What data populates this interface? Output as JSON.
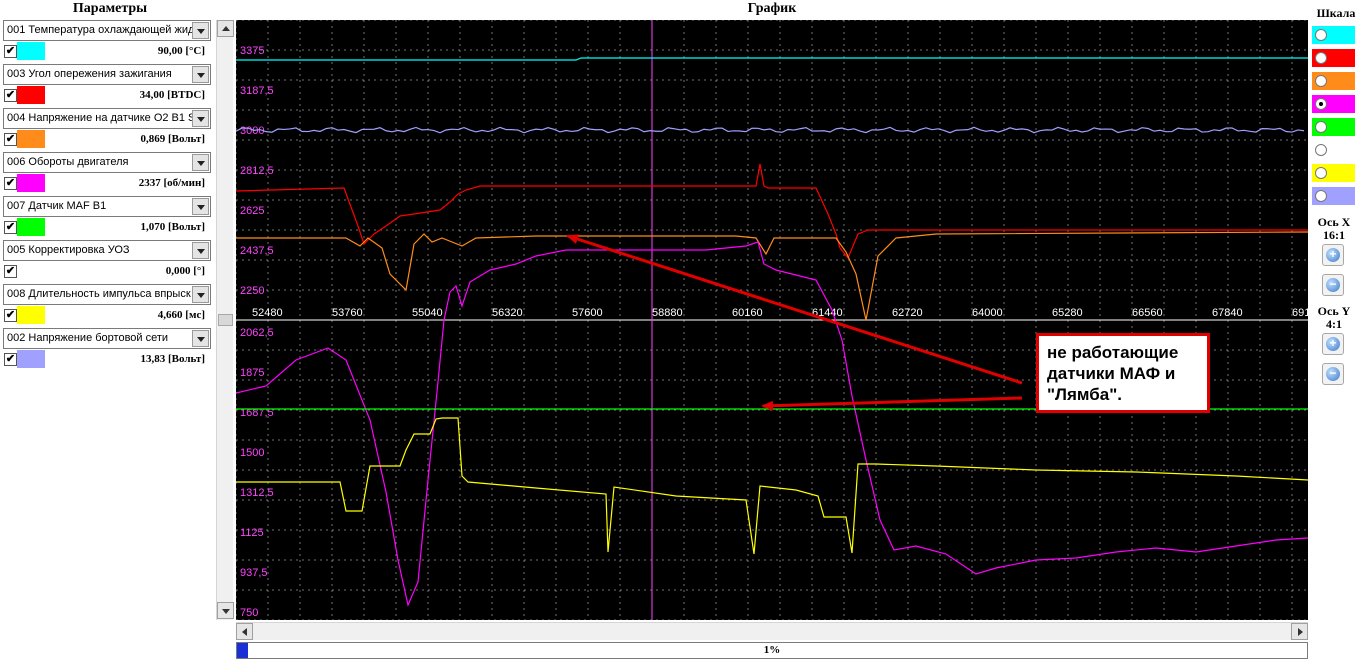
{
  "left_panel": {
    "title": "Параметры",
    "params": [
      {
        "name": "001 Температура охлаждающей жид",
        "value": "90,00 [°C]",
        "color": "#00ffff",
        "checked": true
      },
      {
        "name": "003 Угол опережения зажигания",
        "value": "34,00 [BTDC]",
        "color": "#ff0000",
        "checked": true
      },
      {
        "name": "004 Напряжение на датчике O2 B1 S",
        "value": "0,869 [Вольт]",
        "color": "#ff8c1a",
        "checked": true
      },
      {
        "name": "006 Обороты двигателя",
        "value": "2337 [об/мин]",
        "color": "#ff00ff",
        "checked": true
      },
      {
        "name": "007 Датчик MAF B1",
        "value": "1,070 [Вольт]",
        "color": "#00ff00",
        "checked": true
      },
      {
        "name": "005 Корректировка УОЗ",
        "value": "0,000 [°]",
        "color": "#ffffff",
        "checked": true
      },
      {
        "name": "008 Длительность импульса впрыск",
        "value": "4,660 [мс]",
        "color": "#ffff00",
        "checked": true
      },
      {
        "name": "002 Напряжение бортовой сети",
        "value": "13,83 [Вольт]",
        "color": "#a0a0ff",
        "checked": true
      }
    ],
    "check_mark": "✔"
  },
  "graph": {
    "title": "График",
    "y_ticks_top": [
      "3375",
      "3187,5",
      "3000",
      "2812,5",
      "2625",
      "2437,5",
      "2250"
    ],
    "y_ticks_bottom": [
      "2062,5",
      "1875",
      "1687,5",
      "1500",
      "1312,5",
      "1125",
      "937,5",
      "750"
    ],
    "x_ticks": [
      "52480",
      "53760",
      "55040",
      "56320",
      "57600",
      "58880",
      "60160",
      "61440",
      "62720",
      "64000",
      "65280",
      "66560",
      "67840",
      "691"
    ]
  },
  "scale_panel": {
    "title": "Шкала",
    "selected_index": 3,
    "x_axis_label": "Ось X",
    "x_axis_ratio": "16:1",
    "y_axis_label": "Ось Y",
    "y_axis_ratio": "4:1"
  },
  "progress": {
    "percent": 1,
    "label": "1%"
  },
  "annotation": {
    "line1": "не работающие",
    "line2": "датчики МАФ и",
    "line3": "\"Лямба\"."
  },
  "chart_data": {
    "type": "line",
    "title": "График",
    "x": [
      52480,
      53760,
      55040,
      56320,
      57600,
      58880,
      60160,
      61440,
      62720,
      64000,
      65280,
      66560,
      67840
    ],
    "xlabel": "",
    "ylabel": "",
    "grid": true
  }
}
